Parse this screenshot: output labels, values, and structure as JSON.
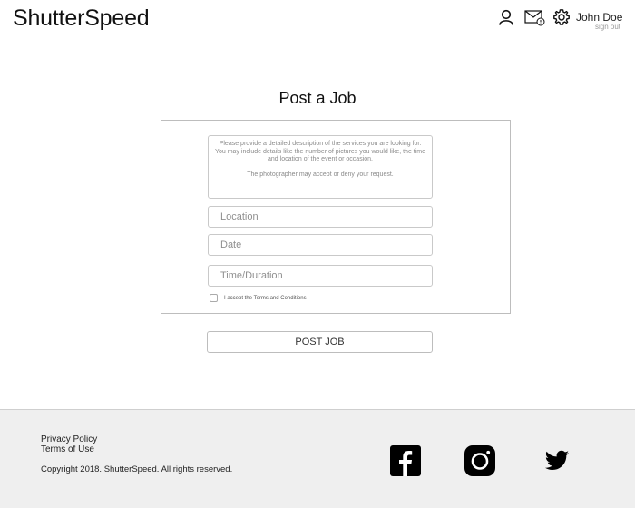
{
  "header": {
    "logo": "ShutterSpeed",
    "user_name": "John Doe",
    "sign_out": "sign out",
    "icons": [
      "profile-icon",
      "mail-notification-icon",
      "gear-icon"
    ]
  },
  "main": {
    "title": "Post a Job",
    "description_lines": [
      "Please provide a detailed description of the services you are looking for.",
      "You may include details like the number of pictures you would like, the time and location of the event or occasion.",
      "The photographer may accept or deny your request."
    ],
    "fields": {
      "location_placeholder": "Location",
      "date_placeholder": "Date",
      "time_placeholder": "Time/Duration"
    },
    "terms_label": "I accept the Terms and Conditions",
    "terms_checked": false,
    "submit_label": "POST JOB"
  },
  "footer": {
    "privacy": "Privacy Policy",
    "terms": "Terms of Use",
    "copyright": "Copyright 2018. ShutterSpeed. All rights reserved.",
    "social": [
      "facebook-icon",
      "instagram-icon",
      "twitter-icon"
    ]
  }
}
